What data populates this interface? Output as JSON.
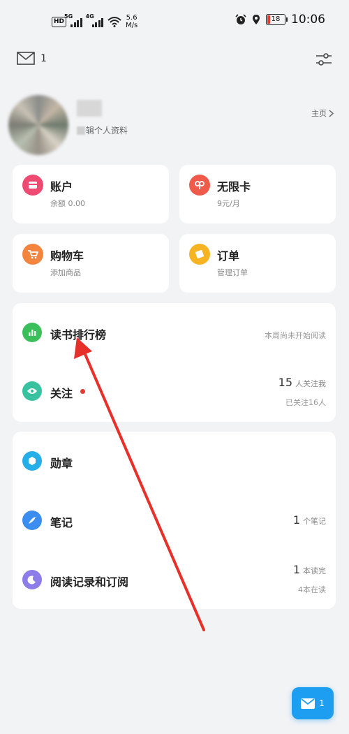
{
  "status_bar": {
    "hd_label": "HD",
    "sim1_label": "5G",
    "sim2_label": "4G",
    "speed_value": "5.6",
    "speed_unit": "M/s",
    "battery": "18",
    "time": "10:06"
  },
  "top_bar": {
    "mail_count": "1"
  },
  "profile": {
    "edit_label": "辑个人资料",
    "home_link": "主页"
  },
  "cards": {
    "account": {
      "title": "账户",
      "subtitle": "余额 0.00",
      "color": "#ef4a72"
    },
    "unlimited": {
      "title": "无限卡",
      "subtitle": "9元/月",
      "color": "#f05a4a"
    },
    "cart": {
      "title": "购物车",
      "subtitle": "添加商品",
      "color": "#f3853f"
    },
    "orders": {
      "title": "订单",
      "subtitle": "管理订单",
      "color": "#f7b422"
    }
  },
  "social": {
    "ranking": {
      "title": "读书排行榜",
      "right": "本周尚未开始阅读",
      "color": "#3bbf5a"
    },
    "follow": {
      "title": "关注",
      "count": "15",
      "count_label": "人关注我",
      "sub": "已关注16人",
      "color": "#39c2a0"
    }
  },
  "records": {
    "badges": {
      "title": "勋章",
      "color": "#26aee8"
    },
    "notes": {
      "title": "笔记",
      "count": "1",
      "count_label": "个笔记",
      "color": "#3b8ef0"
    },
    "reading": {
      "title": "阅读记录和订阅",
      "count": "1",
      "count_label": "本读完",
      "sub": "4本在读",
      "color": "#8d7de8"
    }
  },
  "fab": {
    "count": "1"
  },
  "annotation": {
    "arrow_color": "#e8302a"
  }
}
